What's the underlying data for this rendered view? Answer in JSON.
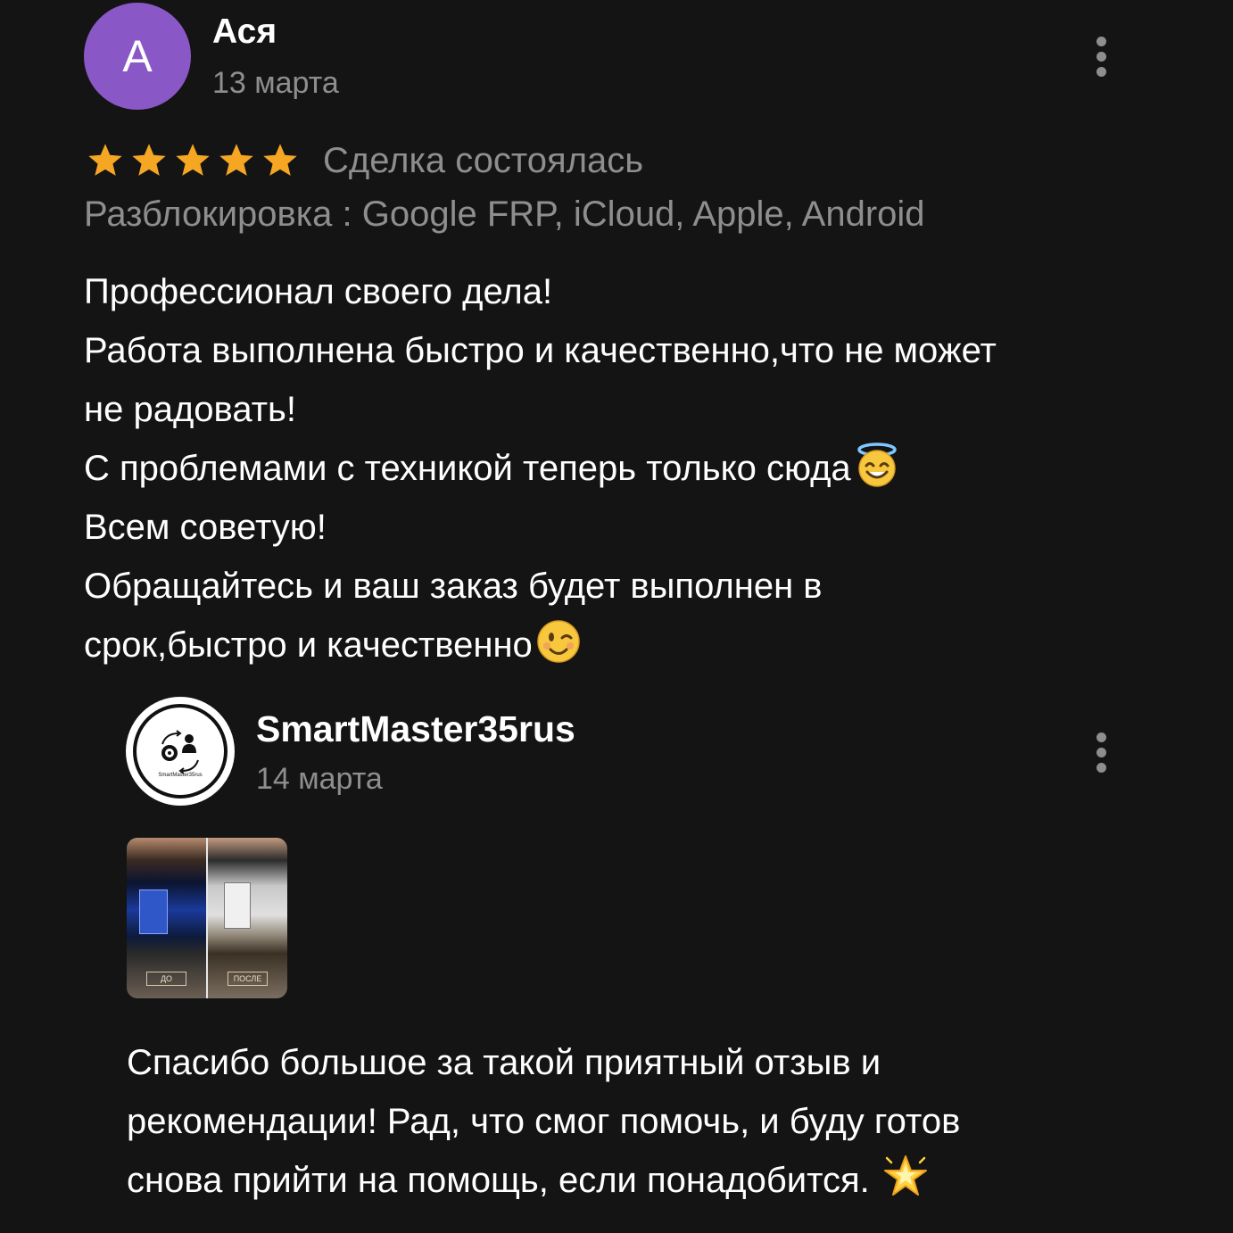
{
  "review": {
    "avatar_letter": "А",
    "avatar_color": "#8a58c6",
    "author": "Ася",
    "date": "13 марта",
    "rating": 5,
    "rating_max": 5,
    "star_color": "#f5a623",
    "deal_status": "Сделка состоялась",
    "service": "Разблокировка : Google FRP, iCloud, Apple, Android",
    "text_lines": [
      "Профессионал своего дела!",
      "Работа выполнена быстро и качественно,что не может",
      "не радовать!",
      "С проблемами с техникой теперь только сюда",
      "Всем советую!",
      "Обращайтесь и ваш заказ будет выполнен в",
      "срок,быстро и качественно"
    ],
    "emoji_line4": "smiling-face-with-halo-icon",
    "emoji_line7": "winking-face-icon",
    "more_icon": "more-vertical-icon"
  },
  "reply": {
    "author": "SmartMaster35rus",
    "avatar_label": "SmartMaster35rus",
    "date": "14 марта",
    "photo_tag_left": "ДО",
    "photo_tag_right": "ПОСЛЕ",
    "text_lines": [
      "Спасибо большое за такой приятный отзыв и",
      "рекомендации! Рад, что смог помочь, и буду готов",
      "снова прийти на помощь, если понадобится."
    ],
    "emoji_end": "glowing-star-icon",
    "more_icon": "more-vertical-icon"
  },
  "colors": {
    "background": "#141414",
    "text_primary": "#ffffff",
    "text_secondary": "#8e8e8e"
  }
}
